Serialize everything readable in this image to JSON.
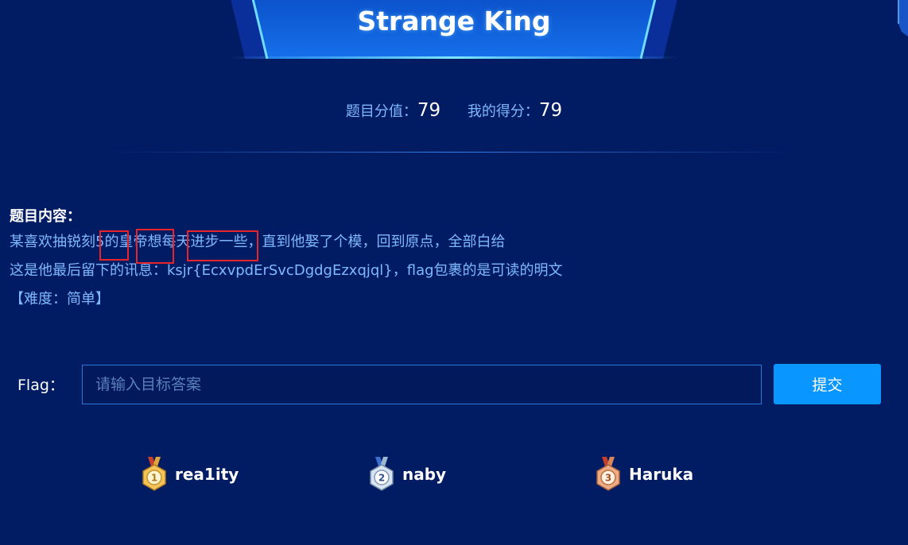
{
  "header": {
    "title": "Strange King"
  },
  "score": {
    "value_label": "题目分值：",
    "value": "79",
    "mine_label": "我的得分：",
    "mine": "79"
  },
  "content": {
    "title": "题目内容：",
    "line1": "某喜欢抽锐刻5的皇帝想每天进步一些，直到他娶了个模，回到原点，全部白给",
    "line2": "这是他最后留下的讯息：ksjr{EcxvpdErSvcDgdgEzxqjql}，flag包裹的是可读的明文",
    "line3": "【难度：简单】"
  },
  "flag": {
    "label": "Flag：",
    "placeholder": "请输入目标答案",
    "value": "",
    "submit_label": "提交"
  },
  "ranking": [
    {
      "rank": "1",
      "name": "rea1ity",
      "medal_color": "#d9a441"
    },
    {
      "rank": "2",
      "name": "naby",
      "medal_color": "#9fb6cf"
    },
    {
      "rank": "3",
      "name": "Haruka",
      "medal_color": "#d9875a"
    }
  ],
  "colors": {
    "background": "#021c64",
    "accent": "#0a96ff",
    "text_blue": "#7fb8ff",
    "highlight_box": "#e8232a"
  }
}
